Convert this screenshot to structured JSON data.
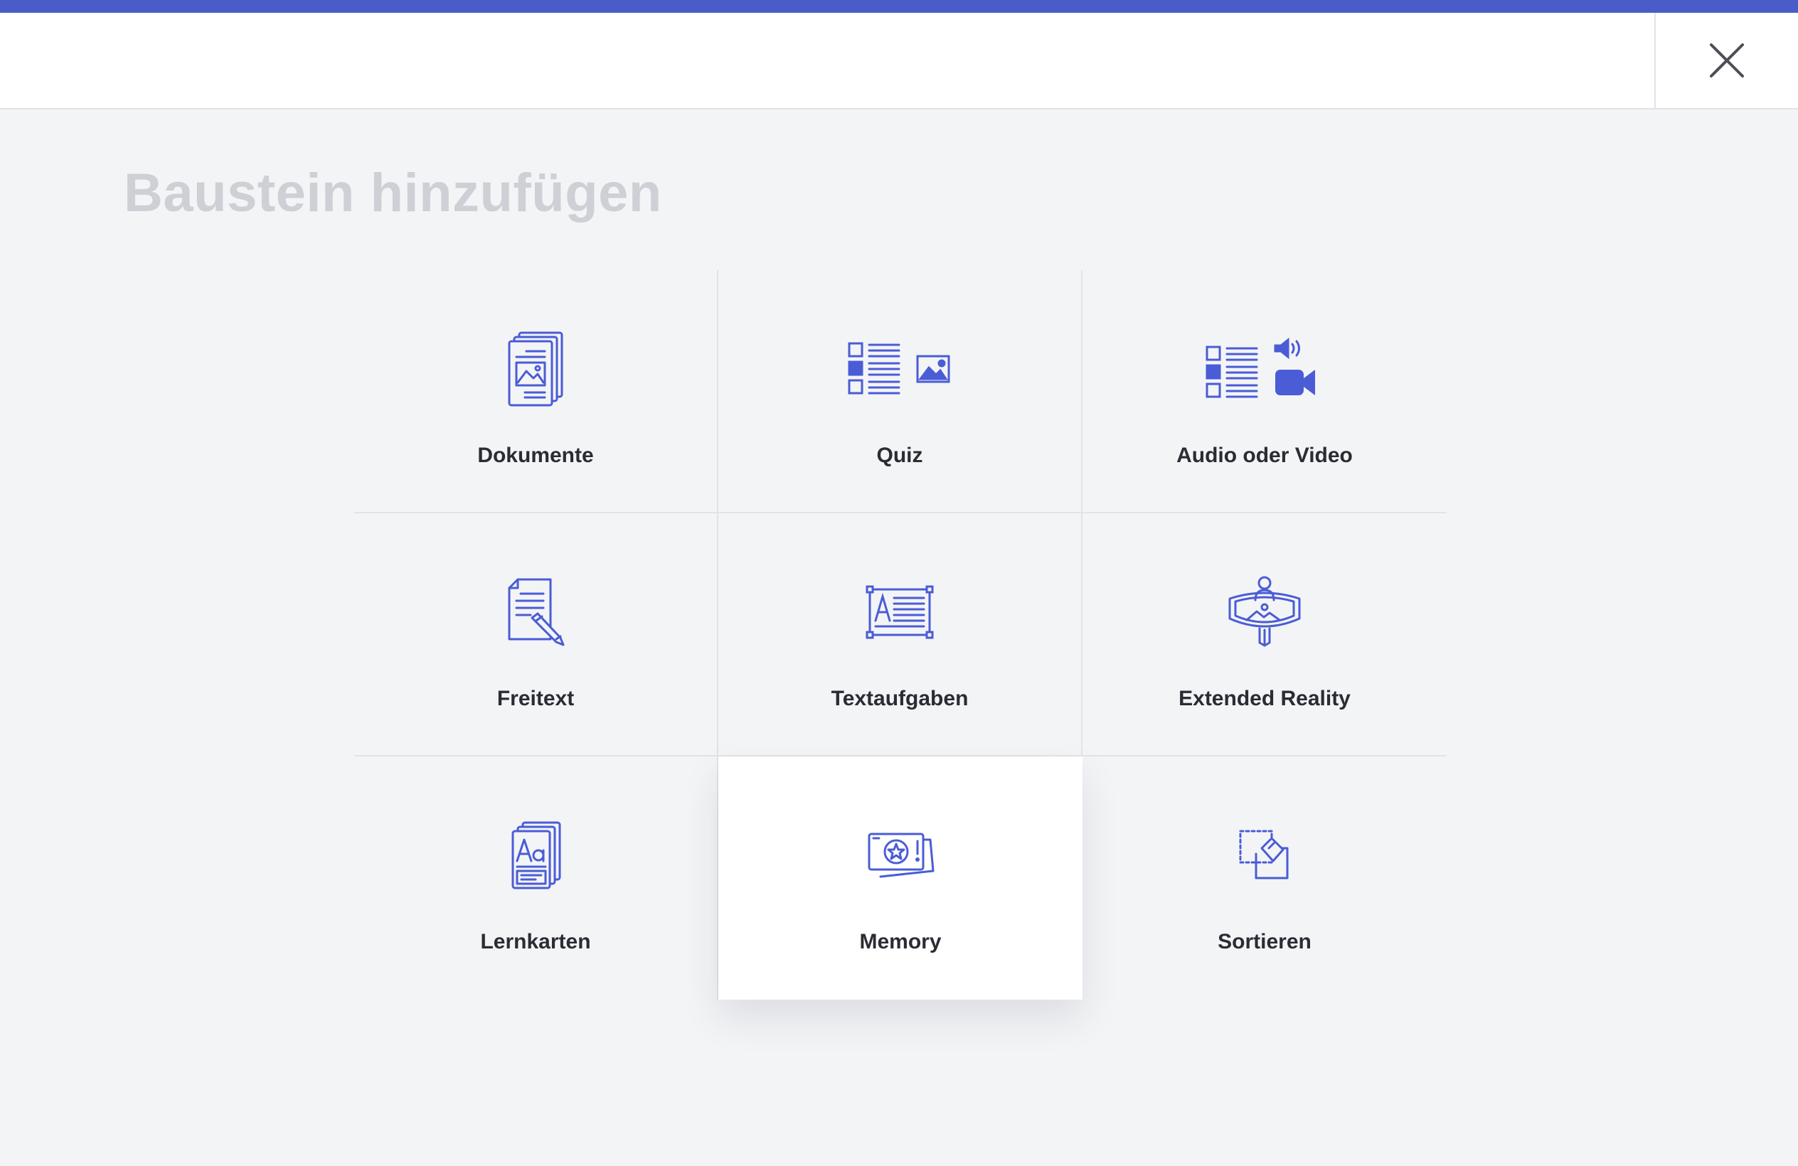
{
  "header": {
    "accent_color": "#4a5cc8",
    "close_icon": "close-icon"
  },
  "page": {
    "title": "Baustein hinzufügen"
  },
  "tiles": [
    {
      "label": "Dokumente",
      "icon": "documents-icon"
    },
    {
      "label": "Quiz",
      "icon": "quiz-icon"
    },
    {
      "label": "Audio oder Video",
      "icon": "audio-video-icon"
    },
    {
      "label": "Freitext",
      "icon": "freetext-icon"
    },
    {
      "label": "Textaufgaben",
      "icon": "text-task-icon"
    },
    {
      "label": "Extended Reality",
      "icon": "extended-reality-icon"
    },
    {
      "label": "Lernkarten",
      "icon": "flashcards-icon"
    },
    {
      "label": "Memory",
      "icon": "memory-icon",
      "selected": true
    },
    {
      "label": "Sortieren",
      "icon": "sort-icon"
    }
  ],
  "colors": {
    "icon": "#4a5cd6",
    "title": "#cfd0d6",
    "label": "#2b2c33"
  }
}
